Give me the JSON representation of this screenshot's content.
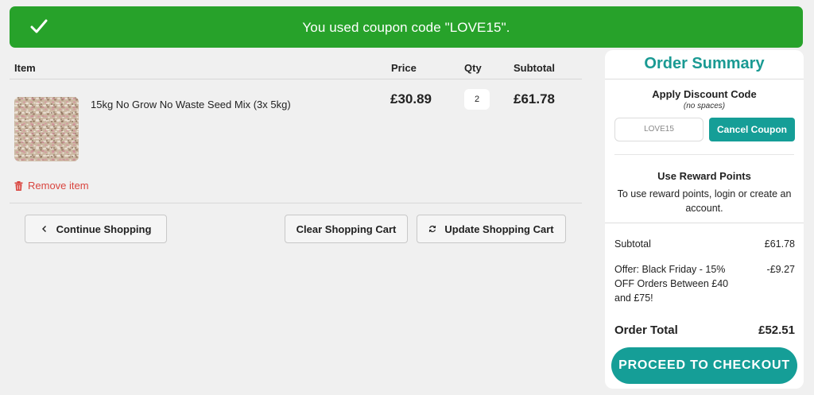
{
  "banner": {
    "message": "You used coupon code \"LOVE15\".",
    "icon": "check-icon",
    "color": "#27a22a"
  },
  "cart": {
    "headers": {
      "item": "Item",
      "price": "Price",
      "qty": "Qty",
      "subtotal": "Subtotal"
    },
    "items": [
      {
        "name": "15kg No Grow No Waste Seed Mix (3x 5kg)",
        "price": "£30.89",
        "qty": "2",
        "subtotal": "£61.78",
        "remove_label": "Remove item"
      }
    ],
    "buttons": {
      "continue": "Continue Shopping",
      "clear": "Clear Shopping Cart",
      "update": "Update Shopping Cart"
    }
  },
  "summary": {
    "title": "Order Summary",
    "discount": {
      "title": "Apply Discount Code",
      "subtitle": "(no spaces)",
      "input_value": "LOVE15",
      "cancel_label": "Cancel Coupon"
    },
    "rewards": {
      "title": "Use Reward Points",
      "text": "To use reward points, login or create an account."
    },
    "lines": {
      "subtotal_label": "Subtotal",
      "subtotal_value": "£61.78",
      "offer_label": "Offer: Black Friday - 15% OFF Orders Between £40 and £75!",
      "offer_value": "-£9.27"
    },
    "total": {
      "label": "Order Total",
      "value": "£52.51"
    },
    "checkout_label": "PROCEED TO CHECKOUT",
    "accent": "#159e97"
  }
}
